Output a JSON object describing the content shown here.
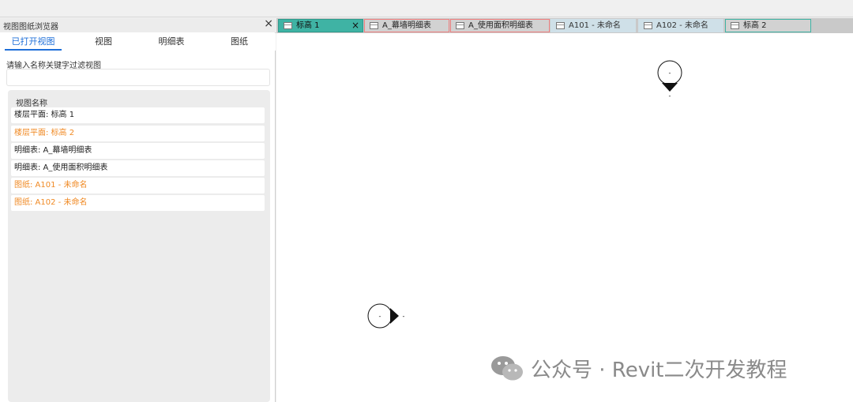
{
  "panel": {
    "title": "视图图纸浏览器",
    "close_icon": "×",
    "tabs": [
      {
        "label": "已打开视图",
        "active": true
      },
      {
        "label": "视图",
        "active": false
      },
      {
        "label": "明细表",
        "active": false
      },
      {
        "label": "图纸",
        "active": false
      }
    ],
    "filter_label": "请输入名称关键字过滤视图",
    "filter_placeholder": "",
    "list_header": "视图名称",
    "items": [
      {
        "label": "楼层平面: 标高 1",
        "color": "#222222"
      },
      {
        "label": "楼层平面: 标高 2",
        "color": "#f08a24"
      },
      {
        "label": "明细表: A_幕墙明细表",
        "color": "#222222"
      },
      {
        "label": "明细表: A_使用面积明细表",
        "color": "#222222"
      },
      {
        "label": "图纸: A101 - 未命名",
        "color": "#f08a24"
      },
      {
        "label": "图纸: A102 - 未命名",
        "color": "#f08a24"
      }
    ]
  },
  "doc_tabs": [
    {
      "label": "标高 1",
      "style": "active",
      "icon": "floor-plan-icon",
      "closable": true
    },
    {
      "label": "A_幕墙明细表",
      "style": "red",
      "icon": "schedule-icon",
      "closable": false
    },
    {
      "label": "A_使用面积明细表",
      "style": "red",
      "icon": "schedule-icon",
      "closable": false
    },
    {
      "label": "A101 - 未命名",
      "style": "plain",
      "icon": "sheet-icon",
      "closable": false
    },
    {
      "label": "A102 - 未命名",
      "style": "plain",
      "icon": "sheet-icon",
      "closable": false
    },
    {
      "label": "标高 2",
      "style": "teal",
      "icon": "floor-plan-icon",
      "closable": false
    }
  ],
  "tab_close_icon": "×",
  "canvas": {
    "marker_top_text": "-",
    "marker_left_text": "-"
  },
  "watermark": {
    "text": "公众号 · Revit二次开发教程",
    "icon": "wechat-icon"
  },
  "colors": {
    "accent": "#1e6fd9",
    "active_tab": "#3fb3a4",
    "highlight_text": "#f08a24",
    "red_border": "#f08080"
  }
}
